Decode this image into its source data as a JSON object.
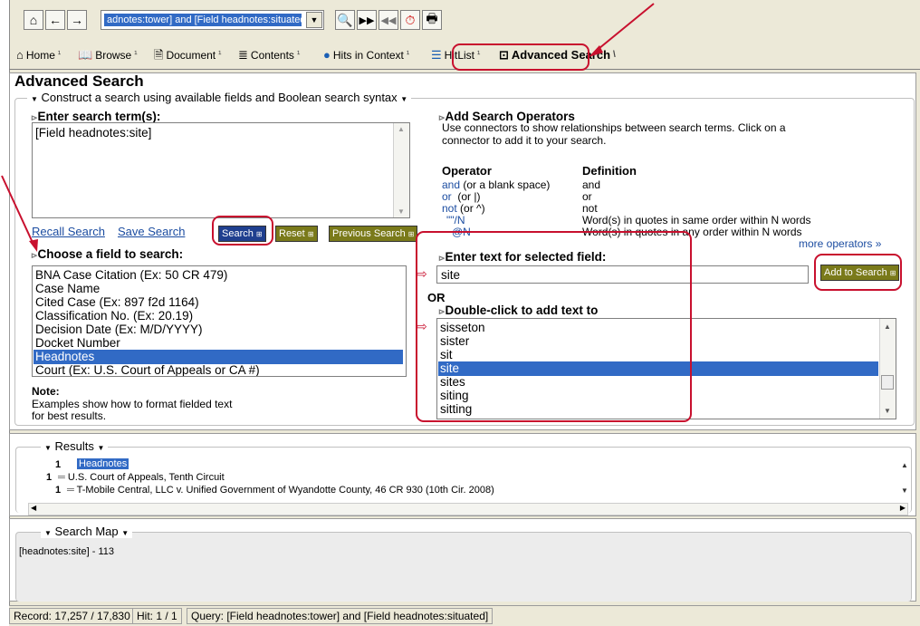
{
  "toolbar": {
    "query_combo": "adnotes:tower] and [Field headnotes:situated]",
    "icons": [
      "home-icon",
      "back-icon",
      "forward-icon",
      "search-icon",
      "next-hit-icon",
      "prev-hit-icon",
      "history-icon",
      "print-icon"
    ]
  },
  "tabs": [
    {
      "label": "Home",
      "icon": "home-icon"
    },
    {
      "label": "Browse",
      "icon": "book-icon"
    },
    {
      "label": "Document",
      "icon": "document-icon"
    },
    {
      "label": "Contents",
      "icon": "contents-icon"
    },
    {
      "label": "Hits in Context",
      "icon": "globe-icon"
    },
    {
      "label": "HitList",
      "icon": "list-icon"
    },
    {
      "label": "Advanced Search",
      "icon": "advanced-search-icon"
    }
  ],
  "advanced": {
    "title": "Advanced Search",
    "group_label": "Construct a search using available fields and Boolean search syntax",
    "enter_terms_heading": "Enter search term(s):",
    "search_text": "[Field headnotes:site]",
    "recall_search": "Recall Search",
    "save_search": "Save Search",
    "search_btn": "Search",
    "reset_btn": "Reset",
    "previous_btn": "Previous Search",
    "choose_field_heading": "Choose a field to search:",
    "fields": [
      "BNA Case Citation (Ex: 50 CR 479)",
      "Case Name",
      "Cited Case (Ex: 897 f2d 1164)",
      "Classification No. (Ex: 20.19)",
      "Decision Date (Ex: M/D/YYYY)",
      "Docket Number",
      "Headnotes",
      "Court (Ex: U.S. Court of Appeals or CA #)"
    ],
    "note_label": "Note:",
    "note_text1": "Examples show how to format fielded text",
    "note_text2": "for best results.",
    "operators_heading": "Add Search Operators",
    "operators_desc1": "Use connectors to show relationships between search terms.  Click on a",
    "operators_desc2": "connector to add it to your search.",
    "col_operator": "Operator",
    "col_definition": "Definition",
    "operators": [
      {
        "op": "and",
        "extra": "(or a blank space)",
        "def": "and"
      },
      {
        "op": "or",
        "extra": "(or |)",
        "def": "or"
      },
      {
        "op": "not",
        "extra": "(or ^)",
        "def": "not"
      },
      {
        "op": "\"\"/N",
        "extra": "",
        "def": "Word(s) in quotes in same order within N words"
      },
      {
        "op": "@N",
        "extra": "",
        "def": "Word(s) in quotes in any order within N words"
      }
    ],
    "more_operators": "more operators »",
    "enter_field_text_heading": "Enter text for selected field:",
    "field_text": "site",
    "add_to_search": "Add to Search",
    "or_label": "OR",
    "double_click_heading": "Double-click to add text to",
    "words": [
      "sisseton",
      "sister",
      "sit",
      "site",
      "sites",
      "siting",
      "sitting"
    ]
  },
  "results": {
    "label": "Results",
    "row1_count": "1",
    "row1_text": "Headnotes",
    "row2_count": "1",
    "row2_text": "U.S. Court of Appeals, Tenth Circuit",
    "row3_count": "1",
    "row3_text": "T-Mobile Central, LLC v. Unified Government of Wyandotte County, 46 CR 930 (10th Cir. 2008)"
  },
  "search_map": {
    "label": "Search Map",
    "text": "[headnotes:site] - 113"
  },
  "status": {
    "record": "Record: 17,257 / 17,830",
    "hit": "Hit: 1 / 1",
    "query": "Query: [Field headnotes:tower] and [Field headnotes:situated]"
  },
  "colors": {
    "accent": "#316ac5",
    "annotation": "#c8102e",
    "button_blue": "#1f3f8f",
    "button_olive": "#7a7a1a"
  }
}
